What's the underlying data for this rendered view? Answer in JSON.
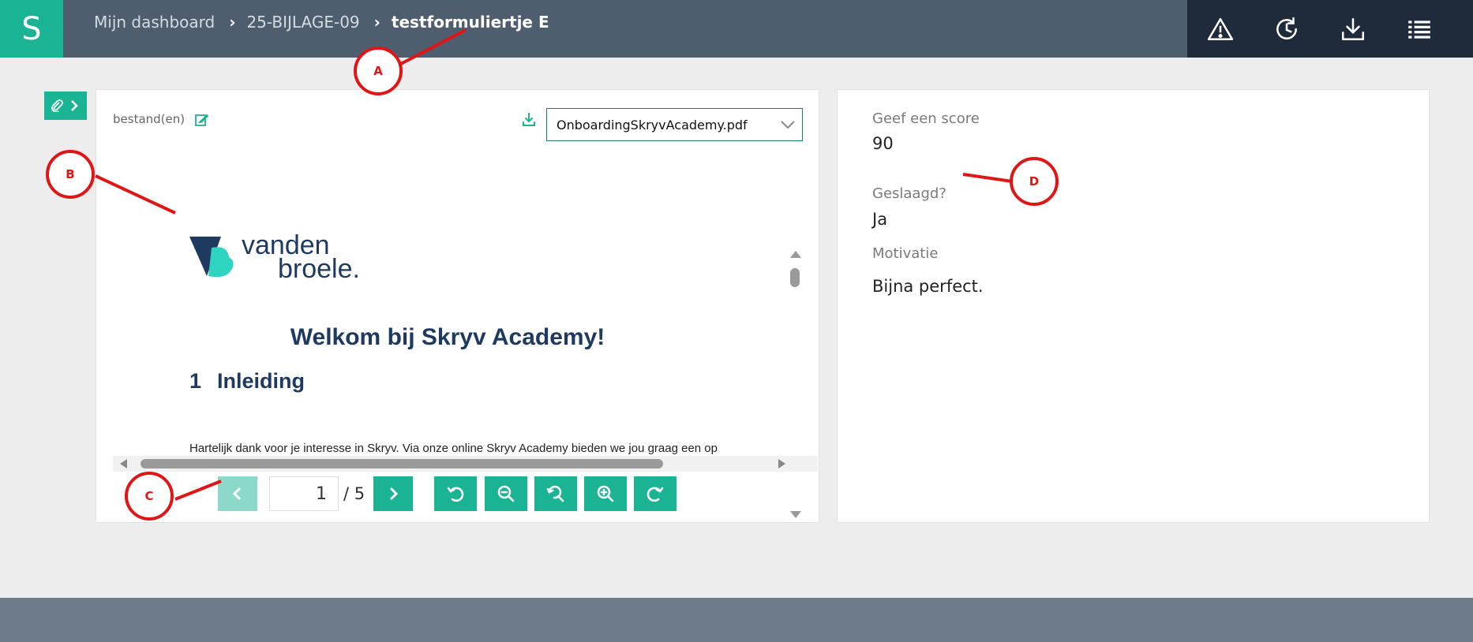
{
  "app": {
    "logo_letter": "S"
  },
  "breadcrumb": {
    "items": [
      "Mijn dashboard",
      "25-BIJLAGE-09"
    ],
    "separator": "›",
    "current": "testformuliertje E"
  },
  "toolbar_right": {
    "icons": [
      "warning-icon",
      "history-icon",
      "download-icon",
      "list-icon"
    ]
  },
  "files": {
    "label": "bestand(en)",
    "selected_file": "OnboardingSkryvAcademy.pdf"
  },
  "pdf": {
    "logo_text_line1": "vanden",
    "logo_text_line2": "broele.",
    "heading": "Welkom bij Skryv Academy!",
    "section_number": "1",
    "section_title": "Inleiding",
    "body_text": "Hartelijk dank voor je interesse in Skryv. Via onze online Skryv Academy bieden we jou graag een op",
    "page_current": "1",
    "page_total": "/ 5"
  },
  "form": {
    "score_label": "Geef een score",
    "score_value": "90",
    "passed_label": "Geslaagd?",
    "passed_value": "Ja",
    "motivation_label": "Motivatie",
    "motivation_value": "Bijna perfect."
  },
  "annotations": {
    "a": "A",
    "b": "B",
    "c": "C",
    "d": "D"
  },
  "colors": {
    "accent": "#1ab394",
    "topbar": "#4f5e6f",
    "topbar_dark": "#1f2b3a",
    "annotation": "#e01616",
    "pdf_heading": "#1f3a60"
  }
}
